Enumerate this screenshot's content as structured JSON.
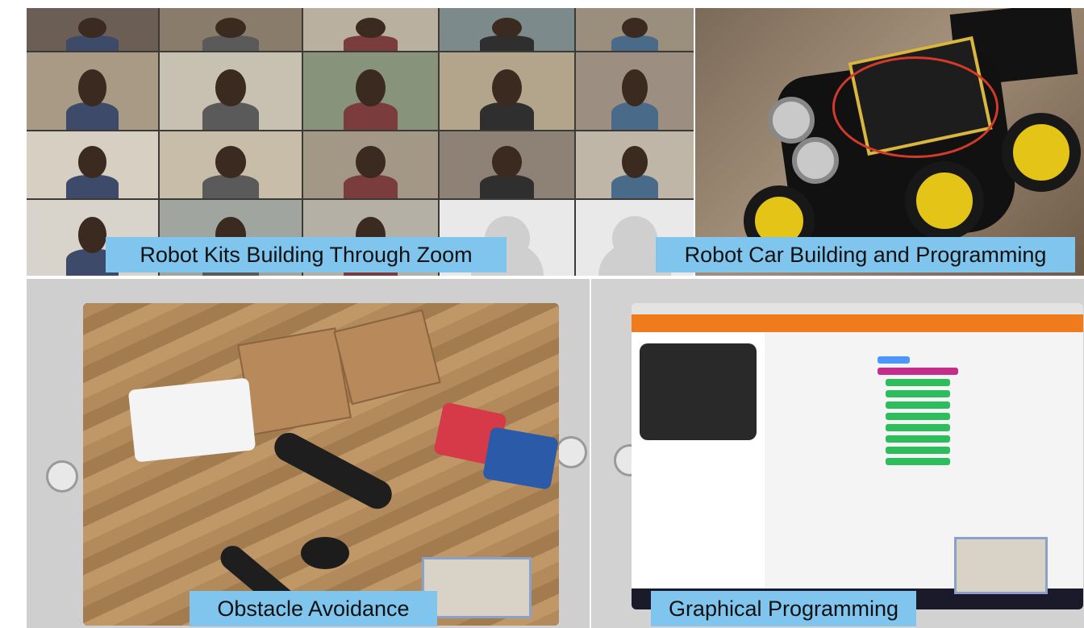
{
  "captions": {
    "top_left": "Robot Kits Building Through Zoom",
    "top_right": "Robot Car Building and Programming",
    "bottom_left": "Obstacle Avoidance",
    "bottom_right": "Graphical Programming"
  },
  "colors": {
    "caption_bg": "#7fc5ee",
    "caption_text": "#111111",
    "makecode_orange": "#f07b1d",
    "makecode_blue": "#4c97ff",
    "makecode_green": "#2ebd5d"
  }
}
